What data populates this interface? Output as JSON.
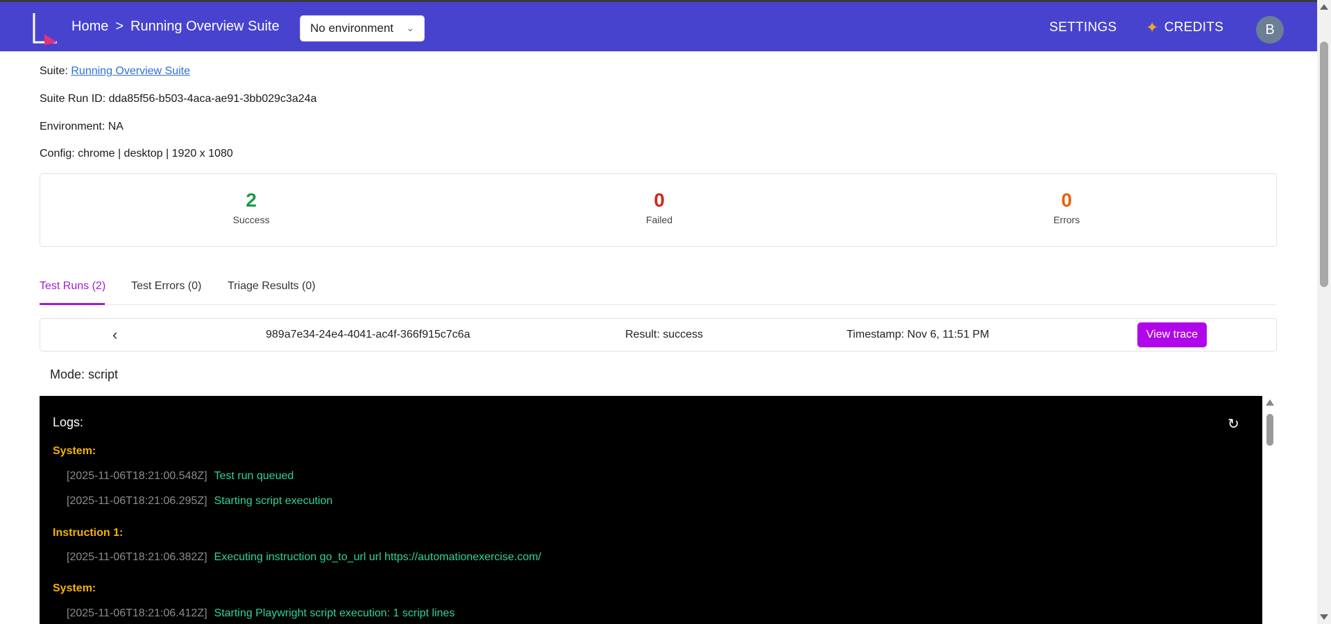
{
  "header": {
    "breadcrumb": [
      "Home",
      ">",
      "Running Overview Suite"
    ],
    "environment_select": "No environment",
    "settings_label": "SETTINGS",
    "credits_label": "CREDITS",
    "avatar_initial": "B",
    "logo_icon": "app-logo-icon",
    "credits_icon": "sparkle-icon"
  },
  "meta": {
    "suite_prefix": "Suite: ",
    "suite_link": "Running Overview Suite",
    "suite_run_id": "Suite Run ID: dda85f56-b503-4aca-ae91-3bb029c3a24a",
    "environment": "Environment: NA",
    "config": "Config: chrome | desktop | 1920 x 1080"
  },
  "stats": [
    {
      "value": "2",
      "label": "Success",
      "color": "#1c9a4c"
    },
    {
      "value": "0",
      "label": "Failed",
      "color": "#d0271b"
    },
    {
      "value": "0",
      "label": "Errors",
      "color": "#e8600f"
    }
  ],
  "tabs": [
    {
      "label": "Test Runs (2)",
      "active": true
    },
    {
      "label": "Test Errors (0)",
      "active": false
    },
    {
      "label": "Triage Results (0)",
      "active": false
    }
  ],
  "run": {
    "back_icon": "chevron-left-icon",
    "id": "989a7e34-24e4-4041-ac4f-366f915c7c6a",
    "result": "Result: success",
    "timestamp": "Timestamp: Nov 6, 11:51 PM",
    "view_trace": "View trace"
  },
  "mode": "Mode: script",
  "logs": {
    "title": "Logs:",
    "refresh_icon": "refresh-icon",
    "sections": [
      {
        "label": "System:",
        "lines": [
          {
            "ts": "[2025-11-06T18:21:00.548Z]",
            "msg": "Test run queued"
          },
          {
            "ts": "[2025-11-06T18:21:06.295Z]",
            "msg": "Starting script execution"
          }
        ]
      },
      {
        "label": "Instruction 1:",
        "lines": [
          {
            "ts": "[2025-11-06T18:21:06.382Z]",
            "msg": "Executing instruction go_to_url url https://automationexercise.com/"
          }
        ]
      },
      {
        "label": "System:",
        "lines": [
          {
            "ts": "[2025-11-06T18:21:06.412Z]",
            "msg": "Starting Playwright script execution: 1 script lines"
          }
        ]
      }
    ]
  },
  "colors": {
    "header_bg": "#4743cf",
    "accent": "#a11bd6",
    "trace_button": "#b007ea",
    "log_section": "#f4b200",
    "log_message": "#2ed3a2"
  }
}
